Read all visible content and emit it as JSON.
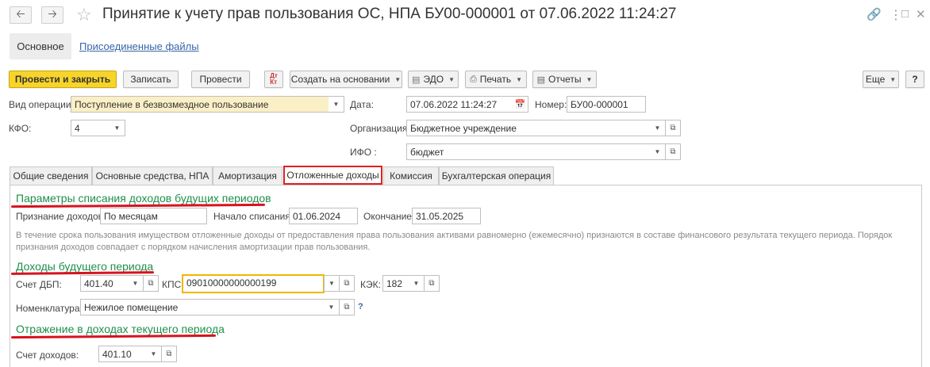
{
  "header": {
    "title": "Принятие к учету прав пользования ОС, НПА БУ00-000001 от 07.06.2022 11:24:27"
  },
  "form_tabs": {
    "main": "Основное",
    "files": "Присоединенные файлы"
  },
  "toolbar": {
    "post_close": "Провести и закрыть",
    "save": "Записать",
    "post": "Провести",
    "create_based": "Создать на основании",
    "edo": "ЭДО",
    "print": "Печать",
    "reports": "Отчеты",
    "more": "Еще",
    "help": "?"
  },
  "fields": {
    "op_type_label": "Вид операции:",
    "op_type_value": "Поступление в безвозмездное пользование",
    "date_label": "Дата:",
    "date_value": "07.06.2022 11:24:27",
    "number_label": "Номер:",
    "number_value": "БУ00-000001",
    "kfo_label": "КФО:",
    "kfo_value": "4",
    "org_label": "Организация:",
    "org_value": "Бюджетное учреждение",
    "ifo_label": "ИФО :",
    "ifo_value": "бюджет"
  },
  "tabs": [
    {
      "label": "Общие сведения"
    },
    {
      "label": "Основные средства, НПА"
    },
    {
      "label": "Амортизация"
    },
    {
      "label": "Отложенные доходы"
    },
    {
      "label": "Комиссия"
    },
    {
      "label": "Бухгалтерская операция"
    }
  ],
  "deferred": {
    "section1": "Параметры списания доходов будущих периодов",
    "recognition_label": "Признание доходов:",
    "recognition_value": "По месяцам",
    "start_label": "Начало списания:",
    "start_value": "01.06.2024",
    "end_label": "Окончание:",
    "end_value": "31.05.2025",
    "note": "В течение срока пользования имуществом отложенные доходы от предоставления права пользования активами равномерно (ежемесячно) признаются в составе финансового результата текущего периода. Порядок признания доходов совпадает с порядком начисления амортизации прав пользования.",
    "section2": "Доходы будущего периода",
    "account_label": "Счет ДБП:",
    "account_value": "401.40",
    "kps_label": "КПС:",
    "kps_value": "09010000000000199",
    "kek_label": "КЭК:",
    "kek_value": "182",
    "nomen_label": "Номенклатура:",
    "nomen_value": "Нежилое помещение",
    "nomen_help": "?",
    "section3": "Отражение в доходах текущего периода",
    "income_label": "Счет доходов:",
    "income_value": "401.10"
  },
  "colors": {
    "primary_button": "#f7d42a",
    "section_green": "#1e8f4a",
    "highlight_red": "#d8121f",
    "link_blue": "#3a65a8",
    "focus_yellow": "#f2b600"
  }
}
